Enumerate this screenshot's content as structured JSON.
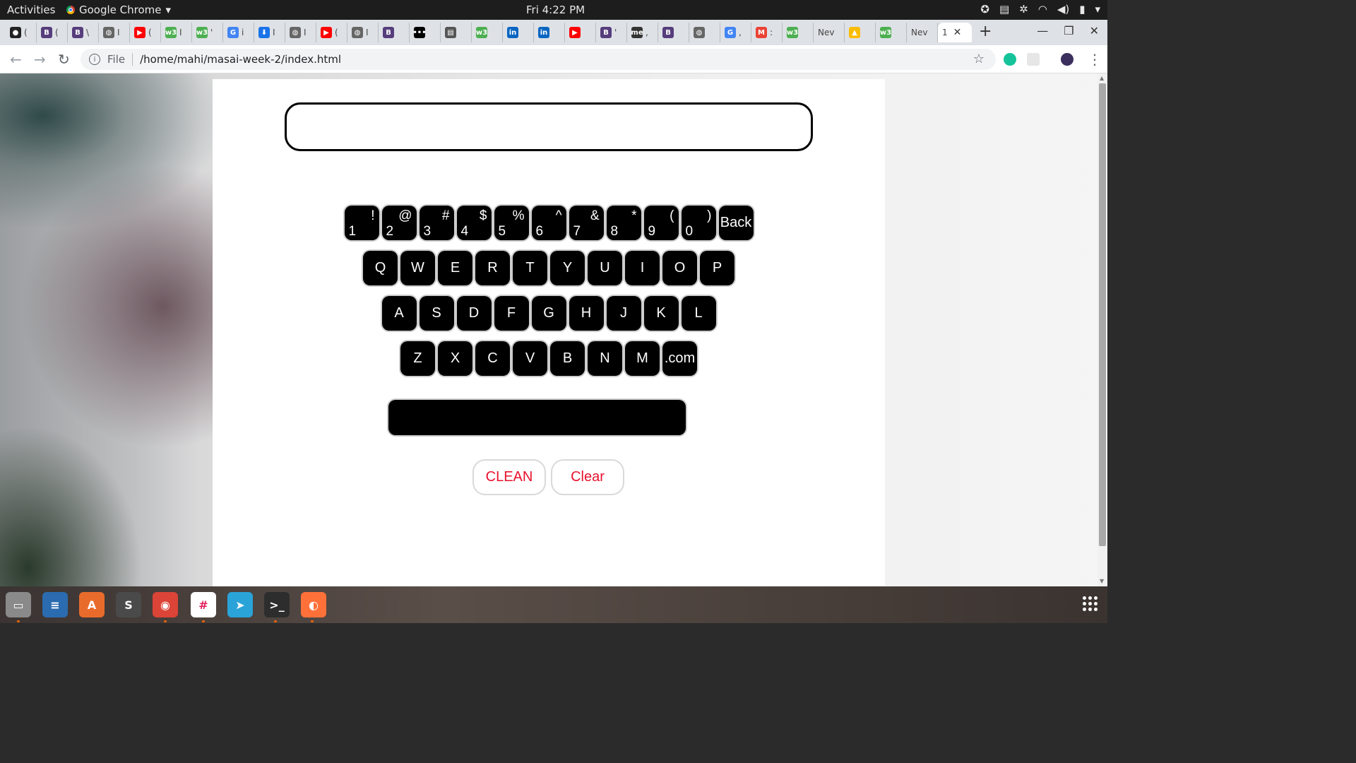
{
  "topbar": {
    "activities": "Activities",
    "app_name": "Google Chrome",
    "app_menu_arrow": "▾",
    "clock": "Fri  4:22 PM",
    "tray_icons": [
      "accessibility-icon",
      "menu-icon",
      "slack-tray-icon",
      "wifi-icon",
      "volume-icon",
      "battery-icon",
      "power-menu-icon"
    ]
  },
  "tabs": [
    {
      "icon": "github-icon",
      "glyph": "●",
      "color": "#222222",
      "text": "("
    },
    {
      "icon": "bootstrap-icon",
      "glyph": "B",
      "color": "#563d7c",
      "text": "("
    },
    {
      "icon": "bootstrap-icon",
      "glyph": "B",
      "color": "#563d7c",
      "text": "\\"
    },
    {
      "icon": "globe-icon",
      "glyph": "◍",
      "color": "#666666",
      "text": "I"
    },
    {
      "icon": "youtube-icon",
      "glyph": "▶",
      "color": "#ff0000",
      "text": "("
    },
    {
      "icon": "w3schools-icon",
      "glyph": "w3",
      "color": "#4caf50",
      "text": "I"
    },
    {
      "icon": "w3schools-icon",
      "glyph": "w3",
      "color": "#4caf50",
      "text": "'"
    },
    {
      "icon": "google-icon",
      "glyph": "G",
      "color": "#4285f4",
      "text": "i"
    },
    {
      "icon": "download-icon",
      "glyph": "⬇",
      "color": "#1a73e8",
      "text": "I"
    },
    {
      "icon": "globe-icon",
      "glyph": "◍",
      "color": "#666666",
      "text": "I"
    },
    {
      "icon": "youtube-icon",
      "glyph": "▶",
      "color": "#ff0000",
      "text": "("
    },
    {
      "icon": "globe-icon",
      "glyph": "◍",
      "color": "#666666",
      "text": "I"
    },
    {
      "icon": "bootstrap-icon",
      "glyph": "B",
      "color": "#563d7c",
      "text": ""
    },
    {
      "icon": "dots-icon",
      "glyph": "•••",
      "color": "#000000",
      "text": ""
    },
    {
      "icon": "news-icon",
      "glyph": "▤",
      "color": "#555555",
      "text": ""
    },
    {
      "icon": "w3schools-icon",
      "glyph": "w3",
      "color": "#4caf50",
      "text": ""
    },
    {
      "icon": "linkedin-icon",
      "glyph": "in",
      "color": "#0a66c2",
      "text": ""
    },
    {
      "icon": "linkedin-icon",
      "glyph": "in",
      "color": "#0a66c2",
      "text": ""
    },
    {
      "icon": "youtube-icon",
      "glyph": "▶",
      "color": "#ff0000",
      "text": ""
    },
    {
      "icon": "bootstrap-icon",
      "glyph": "B",
      "color": "#563d7c",
      "text": "'"
    },
    {
      "icon": "medium-icon",
      "glyph": "me",
      "color": "#333333",
      "text": ","
    },
    {
      "icon": "bootstrap-icon",
      "glyph": "B",
      "color": "#563d7c",
      "text": ""
    },
    {
      "icon": "globe-icon",
      "glyph": "◍",
      "color": "#666666",
      "text": ""
    },
    {
      "icon": "google-icon",
      "glyph": "G",
      "color": "#4285f4",
      "text": ","
    },
    {
      "icon": "gmail-icon",
      "glyph": "M",
      "color": "#ea4335",
      "text": ":"
    },
    {
      "icon": "w3schools-icon",
      "glyph": "w3",
      "color": "#4caf50",
      "text": ""
    },
    {
      "icon": "",
      "glyph": "",
      "color": "",
      "text": "Nev"
    },
    {
      "icon": "google-drive-icon",
      "glyph": "▲",
      "color": "#fbbc04",
      "text": ""
    },
    {
      "icon": "w3schools-icon",
      "glyph": "w3",
      "color": "#4caf50",
      "text": ""
    },
    {
      "icon": "",
      "glyph": "",
      "color": "",
      "text": "Nev"
    }
  ],
  "active_tab": {
    "text": "1",
    "close": "✕"
  },
  "new_tab": "+",
  "window_controls": {
    "minimize": "—",
    "maximize": "❐",
    "close": "✕"
  },
  "toolbar": {
    "back": "←",
    "forward": "→",
    "reload": "↻",
    "scheme_label": "File",
    "url": "/home/mahi/masai-week-2/index.html",
    "star": "☆",
    "menu": "⋮"
  },
  "display": {
    "value": ""
  },
  "keyboard": {
    "number_row": [
      {
        "top": "!",
        "bottom": "1"
      },
      {
        "top": "@",
        "bottom": "2"
      },
      {
        "top": "#",
        "bottom": "3"
      },
      {
        "top": "$",
        "bottom": "4"
      },
      {
        "top": "%",
        "bottom": "5"
      },
      {
        "top": "^",
        "bottom": "6"
      },
      {
        "top": "&",
        "bottom": "7"
      },
      {
        "top": "*",
        "bottom": "8"
      },
      {
        "top": "(",
        "bottom": "9"
      },
      {
        "top": ")",
        "bottom": "0"
      }
    ],
    "back_label": "Back",
    "row_qwerty": [
      "Q",
      "W",
      "E",
      "R",
      "T",
      "Y",
      "U",
      "I",
      "O",
      "P"
    ],
    "row_asdf": [
      "A",
      "S",
      "D",
      "F",
      "G",
      "H",
      "J",
      "K",
      "L"
    ],
    "row_zxcv": [
      "Z",
      "X",
      "C",
      "V",
      "B",
      "N",
      "M",
      ".com"
    ]
  },
  "buttons": {
    "clean": "CLEAN",
    "clear": "Clear"
  },
  "colors": {
    "key_bg": "#000000",
    "accent_text": "#e8112d"
  },
  "dock": [
    {
      "name": "files-app-icon",
      "glyph": "▭",
      "color": "#8a8a8a"
    },
    {
      "name": "writer-app-icon",
      "glyph": "≡",
      "color": "#2b6cb0"
    },
    {
      "name": "software-center-icon",
      "glyph": "A",
      "color": "#e96b2c"
    },
    {
      "name": "sublime-text-icon",
      "glyph": "S",
      "color": "#4a4a4a"
    },
    {
      "name": "chrome-app-icon",
      "glyph": "◉",
      "color": "#db4437"
    },
    {
      "name": "slack-app-icon",
      "glyph": "#",
      "color": "#ffffff"
    },
    {
      "name": "telegram-app-icon",
      "glyph": "➤",
      "color": "#2aa3d8"
    },
    {
      "name": "terminal-app-icon",
      "glyph": ">_",
      "color": "#2d2d2d"
    },
    {
      "name": "firefox-app-icon",
      "glyph": "◐",
      "color": "#ff7139"
    }
  ]
}
